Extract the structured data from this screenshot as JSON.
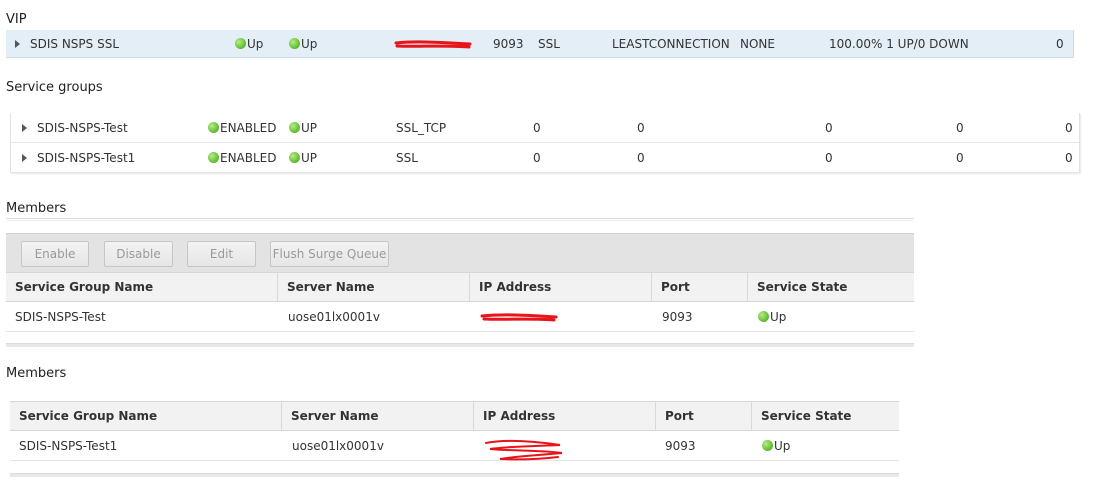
{
  "vip": {
    "title": "VIP",
    "row": {
      "name": "SDIS NSPS SSL",
      "state": "Up",
      "effective_state": "Up",
      "port": "9093",
      "protocol": "SSL",
      "method": "LEASTCONNECTION",
      "persistence": "NONE",
      "health": "100.00% 1 UP/0 DOWN",
      "count": "0"
    }
  },
  "service_groups": {
    "title": "Service groups",
    "rows": [
      {
        "name": "SDIS-NSPS-Test",
        "admin_state": "ENABLED",
        "state": "UP",
        "protocol": "SSL_TCP",
        "c1": "0",
        "c2": "0",
        "c3": "0",
        "c4": "0",
        "c5": "0"
      },
      {
        "name": "SDIS-NSPS-Test1",
        "admin_state": "ENABLED",
        "state": "UP",
        "protocol": "SSL",
        "c1": "0",
        "c2": "0",
        "c3": "0",
        "c4": "0",
        "c5": "0"
      }
    ]
  },
  "members1": {
    "title": "Members",
    "buttons": {
      "enable": "Enable",
      "disable": "Disable",
      "edit": "Edit",
      "flush": "Flush Surge Queue"
    },
    "columns": [
      "Service Group Name",
      "Server Name",
      "IP Address",
      "Port",
      "Service State"
    ],
    "row": {
      "group": "SDIS-NSPS-Test",
      "server": "uose01lx0001v",
      "port": "9093",
      "state": "Up"
    }
  },
  "members2": {
    "title": "Members",
    "columns": [
      "Service Group Name",
      "Server Name",
      "IP Address",
      "Port",
      "Service State"
    ],
    "row": {
      "group": "SDIS-NSPS-Test1",
      "server": "uose01lx0001v",
      "port": "9093",
      "state": "Up"
    }
  },
  "colors": {
    "status_up": "#6cc63c",
    "redaction": "#e8141b",
    "vip_row_bg": "#e4eef6"
  },
  "icons": {
    "expand": "caret-right-icon",
    "status": "green-dot-icon"
  }
}
